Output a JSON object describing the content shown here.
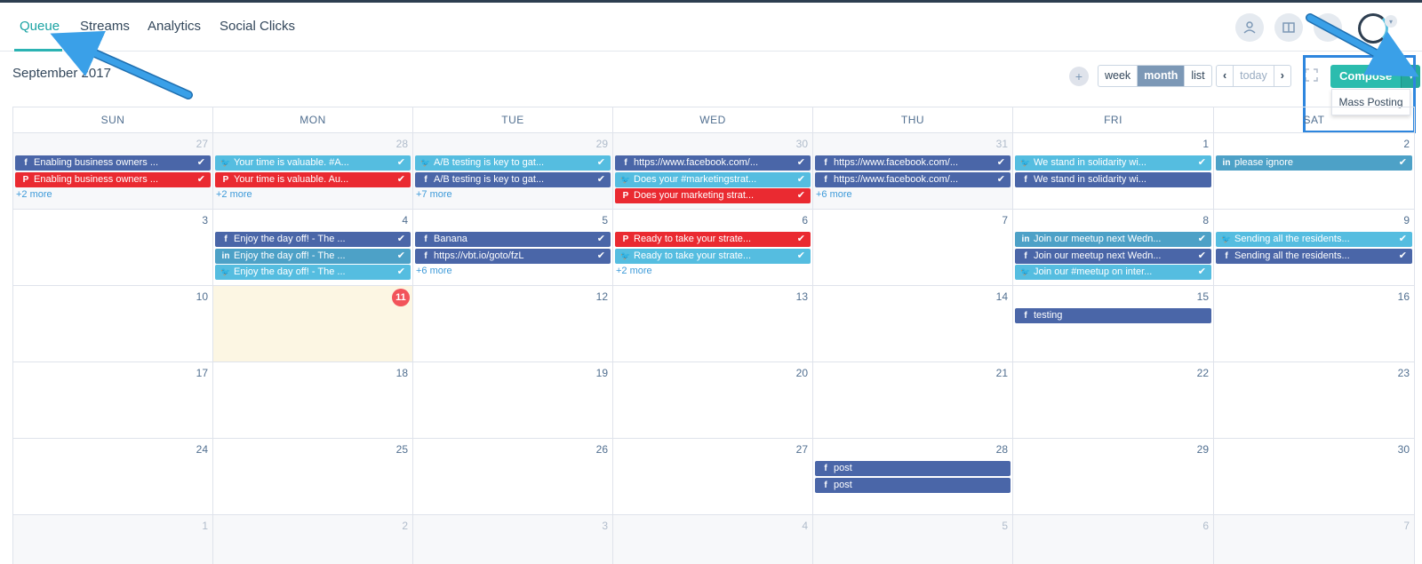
{
  "nav": {
    "tabs": [
      {
        "label": "Queue"
      },
      {
        "label": "Streams"
      },
      {
        "label": "Analytics"
      },
      {
        "label": "Social Clicks"
      }
    ]
  },
  "header": {
    "title": "September 2017",
    "add_icon": "plus-icon"
  },
  "views": {
    "week": "week",
    "month": "month",
    "list": "list",
    "selected": "month"
  },
  "navigation": {
    "prev": "‹",
    "today": "today",
    "next": "›"
  },
  "compose": {
    "label": "Compose",
    "caret": "▾",
    "dropdown_item": "Mass Posting"
  },
  "calendar": {
    "weekdays": [
      "SUN",
      "MON",
      "TUE",
      "WED",
      "THU",
      "FRI",
      "SAT"
    ],
    "today": "11",
    "weeks": [
      [
        {
          "day": "27",
          "other": true,
          "events": [
            {
              "net": "fb",
              "text": "Enabling business owners ..."
            },
            {
              "net": "pin",
              "text": "Enabling business owners ..."
            }
          ],
          "more": "+2 more"
        },
        {
          "day": "28",
          "other": true,
          "events": [
            {
              "net": "tw",
              "text": "Your time is valuable. #A..."
            },
            {
              "net": "pin",
              "text": "Your time is valuable. Au..."
            }
          ],
          "more": "+2 more"
        },
        {
          "day": "29",
          "other": true,
          "events": [
            {
              "net": "tw",
              "text": "A/B testing is key to gat..."
            },
            {
              "net": "fb",
              "text": "A/B testing is key to gat..."
            }
          ],
          "more": "+7 more"
        },
        {
          "day": "30",
          "other": true,
          "events": [
            {
              "net": "fb",
              "text": "https://www.facebook.com/..."
            },
            {
              "net": "tw",
              "text": "Does your #marketingstrat..."
            },
            {
              "net": "pin",
              "text": "Does your marketing strat..."
            }
          ],
          "more": ""
        },
        {
          "day": "31",
          "other": true,
          "events": [
            {
              "net": "fb",
              "text": "https://www.facebook.com/..."
            },
            {
              "net": "fb",
              "text": "https://www.facebook.com/..."
            }
          ],
          "more": "+6 more"
        },
        {
          "day": "1",
          "other": false,
          "events": [
            {
              "net": "tw",
              "text": "We stand in solidarity wi..."
            },
            {
              "net": "fb",
              "text": "We stand in solidarity wi...",
              "nocheck": true
            }
          ],
          "more": ""
        },
        {
          "day": "2",
          "other": false,
          "events": [
            {
              "net": "li",
              "text": "please ignore"
            }
          ],
          "more": ""
        }
      ],
      [
        {
          "day": "3",
          "other": false,
          "events": [],
          "more": ""
        },
        {
          "day": "4",
          "other": false,
          "events": [
            {
              "net": "fb",
              "text": "Enjoy the day off! - The ..."
            },
            {
              "net": "li",
              "text": "Enjoy the day off! - The ..."
            },
            {
              "net": "tw",
              "text": "Enjoy the day off! - The ..."
            }
          ],
          "more": ""
        },
        {
          "day": "5",
          "other": false,
          "events": [
            {
              "net": "fb",
              "text": "Banana"
            },
            {
              "net": "fb",
              "text": "https://vbt.io/goto/fzL"
            }
          ],
          "more": "+6 more"
        },
        {
          "day": "6",
          "other": false,
          "events": [
            {
              "net": "pin",
              "text": "Ready to take your strate..."
            },
            {
              "net": "tw",
              "text": "Ready to take your strate..."
            }
          ],
          "more": "+2 more"
        },
        {
          "day": "7",
          "other": false,
          "events": [],
          "more": ""
        },
        {
          "day": "8",
          "other": false,
          "events": [
            {
              "net": "li",
              "text": "Join our meetup next Wedn..."
            },
            {
              "net": "fb",
              "text": "Join our meetup next Wedn..."
            },
            {
              "net": "tw",
              "text": "Join our #meetup on inter..."
            }
          ],
          "more": ""
        },
        {
          "day": "9",
          "other": false,
          "events": [
            {
              "net": "tw",
              "text": "Sending all the residents..."
            },
            {
              "net": "fb",
              "text": "Sending all the residents..."
            }
          ],
          "more": ""
        }
      ],
      [
        {
          "day": "10",
          "other": false,
          "events": [],
          "more": ""
        },
        {
          "day": "11",
          "other": false,
          "is_today": true,
          "events": [],
          "more": ""
        },
        {
          "day": "12",
          "other": false,
          "events": [],
          "more": ""
        },
        {
          "day": "13",
          "other": false,
          "events": [],
          "more": ""
        },
        {
          "day": "14",
          "other": false,
          "events": [],
          "more": ""
        },
        {
          "day": "15",
          "other": false,
          "events": [
            {
              "net": "fb",
              "text": "testing",
              "nocheck": true
            }
          ],
          "more": ""
        },
        {
          "day": "16",
          "other": false,
          "events": [],
          "more": ""
        }
      ],
      [
        {
          "day": "17",
          "other": false,
          "events": [],
          "more": ""
        },
        {
          "day": "18",
          "other": false,
          "events": [],
          "more": ""
        },
        {
          "day": "19",
          "other": false,
          "events": [],
          "more": ""
        },
        {
          "day": "20",
          "other": false,
          "events": [],
          "more": ""
        },
        {
          "day": "21",
          "other": false,
          "events": [],
          "more": ""
        },
        {
          "day": "22",
          "other": false,
          "events": [],
          "more": ""
        },
        {
          "day": "23",
          "other": false,
          "events": [],
          "more": ""
        }
      ],
      [
        {
          "day": "24",
          "other": false,
          "events": [],
          "more": ""
        },
        {
          "day": "25",
          "other": false,
          "events": [],
          "more": ""
        },
        {
          "day": "26",
          "other": false,
          "events": [],
          "more": ""
        },
        {
          "day": "27",
          "other": false,
          "events": [],
          "more": ""
        },
        {
          "day": "28",
          "other": false,
          "events": [
            {
              "net": "fb",
              "text": "post",
              "nocheck": true
            },
            {
              "net": "fb",
              "text": "post",
              "nocheck": true
            }
          ],
          "more": ""
        },
        {
          "day": "29",
          "other": false,
          "events": [],
          "more": ""
        },
        {
          "day": "30",
          "other": false,
          "events": [],
          "more": ""
        }
      ],
      [
        {
          "day": "1",
          "other": true,
          "events": [],
          "more": ""
        },
        {
          "day": "2",
          "other": true,
          "events": [],
          "more": ""
        },
        {
          "day": "3",
          "other": true,
          "events": [],
          "more": ""
        },
        {
          "day": "4",
          "other": true,
          "events": [],
          "more": ""
        },
        {
          "day": "5",
          "other": true,
          "events": [],
          "more": ""
        },
        {
          "day": "6",
          "other": true,
          "events": [],
          "more": ""
        },
        {
          "day": "7",
          "other": true,
          "events": [],
          "more": ""
        }
      ]
    ]
  },
  "colors": {
    "facebook": "#4a66a8",
    "twitter": "#55bde0",
    "pinterest": "#ea2a31",
    "linkedin": "#4da1c7",
    "accent": "#2bbcae",
    "today_bg": "#fcf6e3",
    "annotation_arrow": "#3aa0e8"
  },
  "icons": {
    "facebook": "f",
    "twitter": "twitter-bird",
    "pinterest": "pinterest-p",
    "linkedin": "in",
    "check": "✔"
  }
}
